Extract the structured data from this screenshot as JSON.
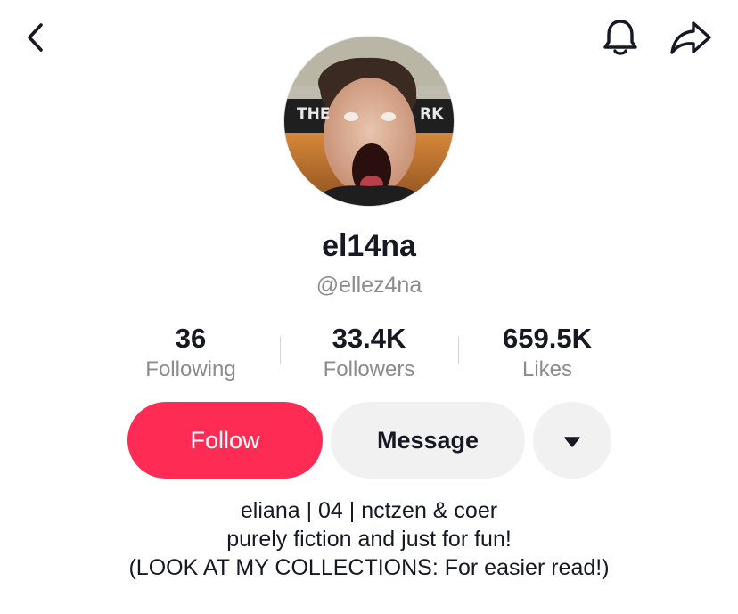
{
  "header": {
    "back_icon": "chevron-left-icon",
    "bell_icon": "bell-icon",
    "share_icon": "share-arrow-icon"
  },
  "profile": {
    "display_name": "el14na",
    "username": "@ellez4na",
    "avatar_sign_text": [
      "THE",
      "RK"
    ]
  },
  "stats": [
    {
      "count": "36",
      "label": "Following"
    },
    {
      "count": "33.4K",
      "label": "Followers"
    },
    {
      "count": "659.5K",
      "label": "Likes"
    }
  ],
  "actions": {
    "follow_label": "Follow",
    "message_label": "Message",
    "more_icon": "caret-down-icon",
    "follow_color": "#fe2c55"
  },
  "bio": {
    "lines": [
      "eliana | 04 | nctzen & coer",
      "purely fiction and just for fun!",
      "(LOOK AT MY COLLECTIONS: For easier read!)"
    ]
  }
}
